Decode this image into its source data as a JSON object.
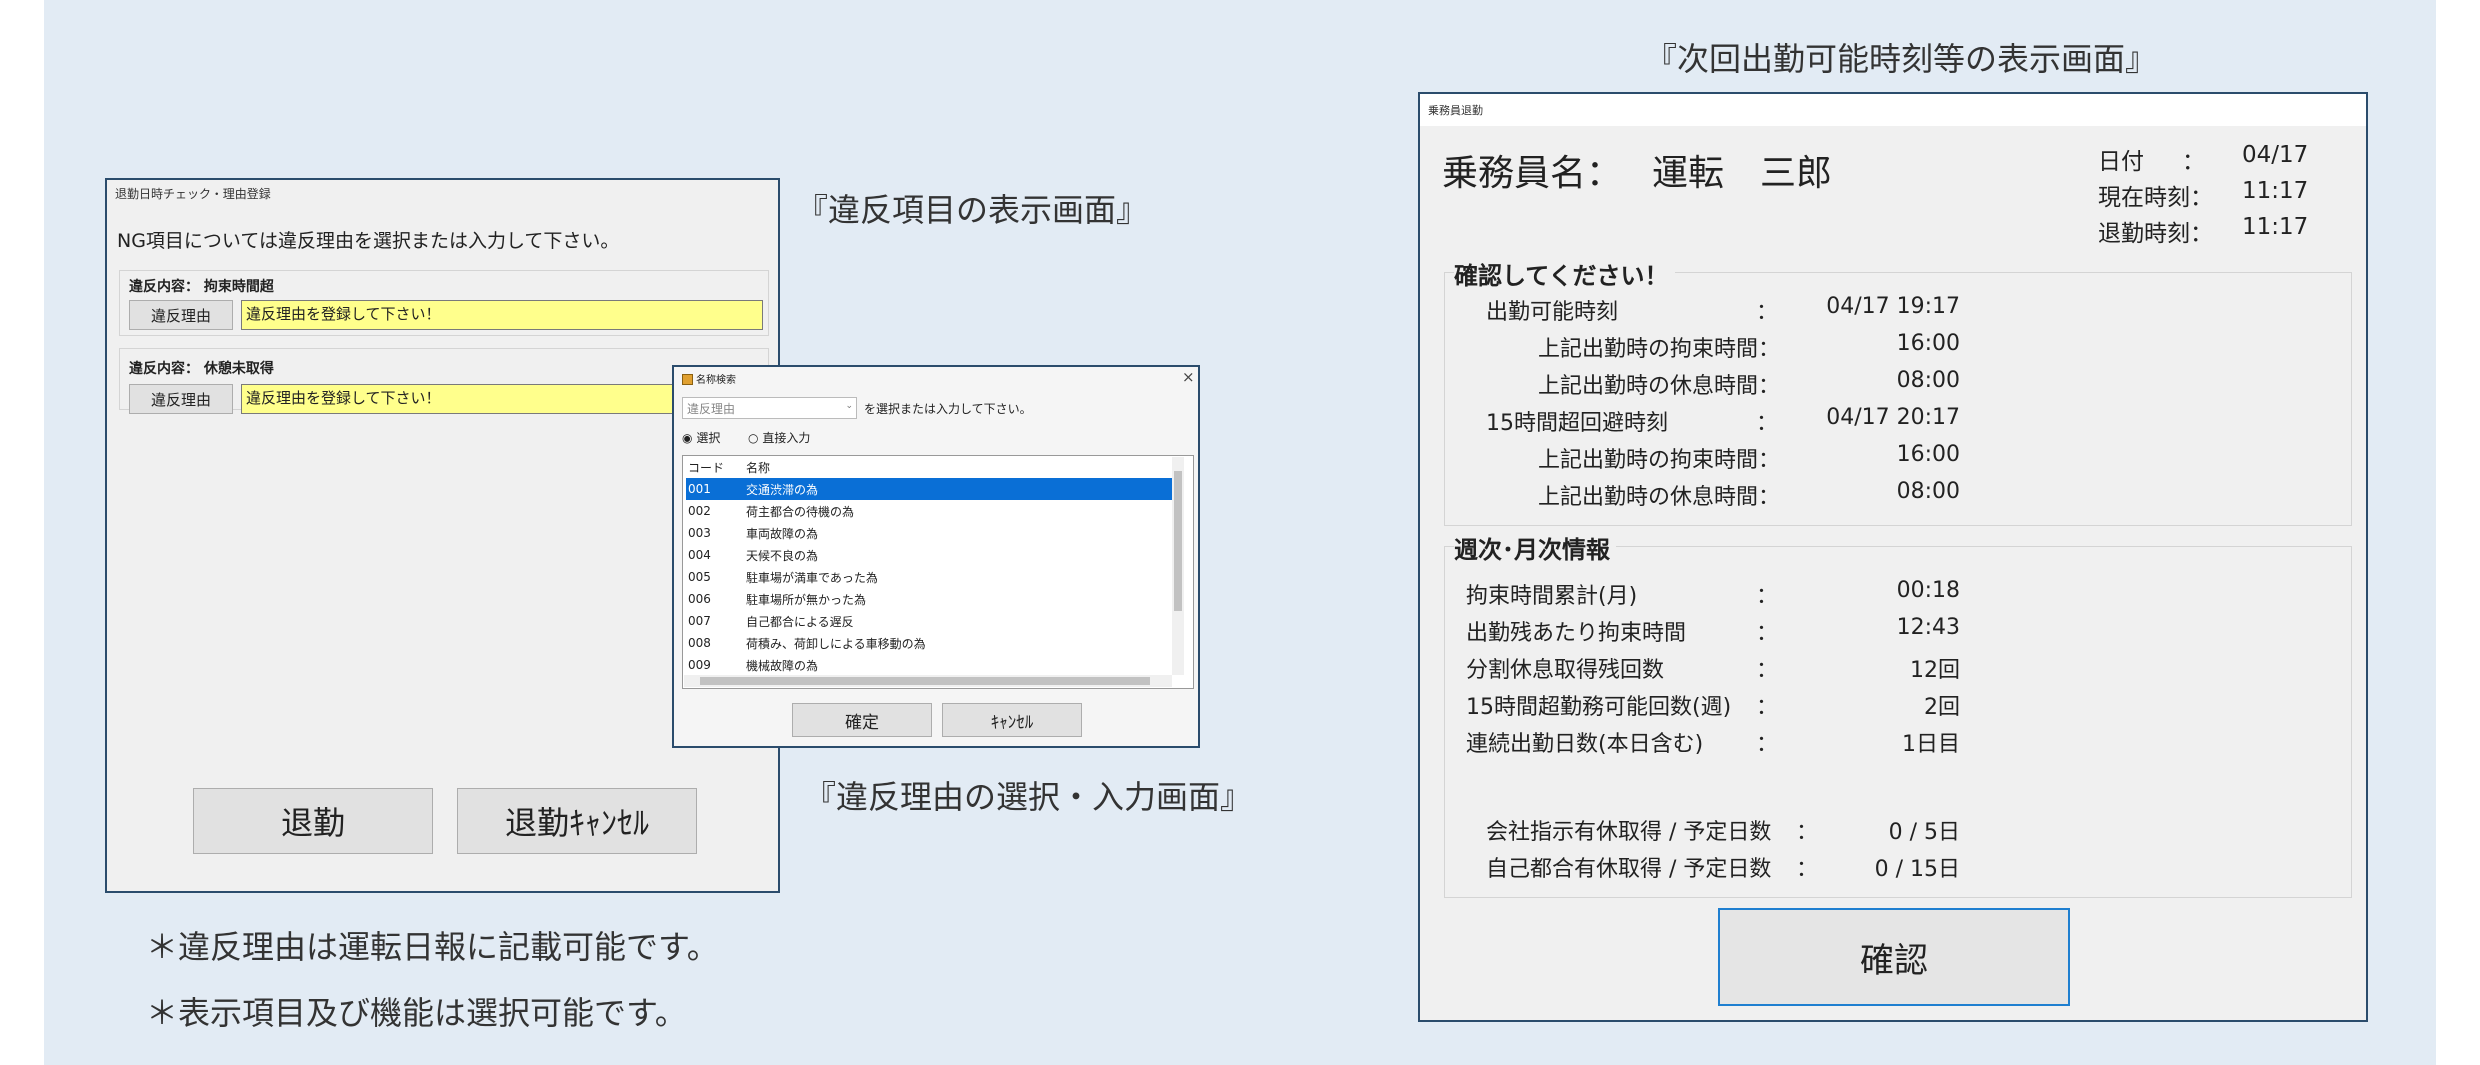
{
  "captions": {
    "next_time_screen": "『次回出勤可能時刻等の表示画面』",
    "violation_items_screen": "『違反項目の表示画面』",
    "violation_reason_screen": "『違反理由の選択・入力画面』"
  },
  "notes": [
    "＊違反理由は運転日報に記載可能です。",
    "＊表示項目及び機能は選択可能です。"
  ],
  "check_window": {
    "title": "退勤日時チェック・理由登録",
    "instruction": "NG項目については違反理由を選択または入力して下さい。",
    "violations": [
      {
        "label": "違反内容： 拘束時間超",
        "button": "違反理由",
        "value": "違反理由を登録して下さい！"
      },
      {
        "label": "違反内容： 休憩未取得",
        "button": "違反理由",
        "value": "違反理由を登録して下さい！"
      }
    ],
    "clock_out_button": "退勤",
    "clock_out_cancel_button": "退勤ｷｬﾝｾﾙ"
  },
  "search_dialog": {
    "title": "名称検索",
    "close_glyph": "×",
    "combo_placeholder": "違反理由",
    "combo_hint": "を選択または入力して下さい。",
    "radio_select": "選択",
    "radio_direct": "直接入力",
    "radio_select_glyph": "◉",
    "radio_direct_glyph": "○",
    "col_code": "コード",
    "col_name": "名称",
    "rows": [
      {
        "code": "001",
        "name": "交通渋滞の為"
      },
      {
        "code": "002",
        "name": "荷主都合の待機の為"
      },
      {
        "code": "003",
        "name": "車両故障の為"
      },
      {
        "code": "004",
        "name": "天候不良の為"
      },
      {
        "code": "005",
        "name": "駐車場が満車であった為"
      },
      {
        "code": "006",
        "name": "駐車場所が無かった為"
      },
      {
        "code": "007",
        "name": "自己都合による遅反"
      },
      {
        "code": "008",
        "name": "荷積み、荷卸しによる車移動の為"
      },
      {
        "code": "009",
        "name": "機械故障の為"
      }
    ],
    "selected_index": 0,
    "ok_button": "確定",
    "cancel_button": "ｷｬﾝｾﾙ"
  },
  "clockout_window": {
    "title": "乗務員退勤",
    "crew_label": "乗務員名：",
    "crew_name": "運転　三郎",
    "date_label": "日付",
    "colon": "：",
    "date_value": "04/17",
    "now_label": "現在時刻：",
    "now_value": "11:17",
    "out_label": "退勤時刻：",
    "out_value": "11:17",
    "confirm_title": "確認してください！",
    "confirm_rows": [
      {
        "label": "出勤可能時刻",
        "colon": "：",
        "value": "04/17 19:17"
      },
      {
        "label": "上記出勤時の拘束時間：",
        "colon": "",
        "value": "16:00"
      },
      {
        "label": "上記出勤時の休息時間：",
        "colon": "",
        "value": "08:00"
      },
      {
        "label": "15時間超回避時刻",
        "colon": "：",
        "value": "04/17 20:17"
      },
      {
        "label": "上記出勤時の拘束時間：",
        "colon": "",
        "value": "16:00"
      },
      {
        "label": "上記出勤時の休息時間：",
        "colon": "",
        "value": "08:00"
      }
    ],
    "weekly_title": "週次･月次情報",
    "weekly_rows": [
      {
        "label": "拘束時間累計(月)",
        "colon": "：",
        "value": "00:18"
      },
      {
        "label": "出勤残あたり拘束時間",
        "colon": "：",
        "value": "12:43"
      },
      {
        "label": "分割休息取得残回数",
        "colon": "：",
        "value": "12回"
      },
      {
        "label": "15時間超勤務可能回数(週)",
        "colon": "：",
        "value": "2回"
      },
      {
        "label": "連続出勤日数(本日含む)",
        "colon": "：",
        "value": "1日目"
      }
    ],
    "leave_rows": [
      {
        "label": "会社指示有休取得 / 予定日数",
        "colon": "：",
        "value": "0 / 5日"
      },
      {
        "label": "自己都合有休取得 / 予定日数",
        "colon": "：",
        "value": "0 / 15日"
      }
    ],
    "confirm_button": "確認"
  },
  "colors": {
    "background": "#e2ebf4",
    "window_border": "#2b4c6c",
    "highlight_field": "#ffff8c",
    "list_selection": "#0a6fd6",
    "confirm_button_border": "#1f7fd0"
  }
}
